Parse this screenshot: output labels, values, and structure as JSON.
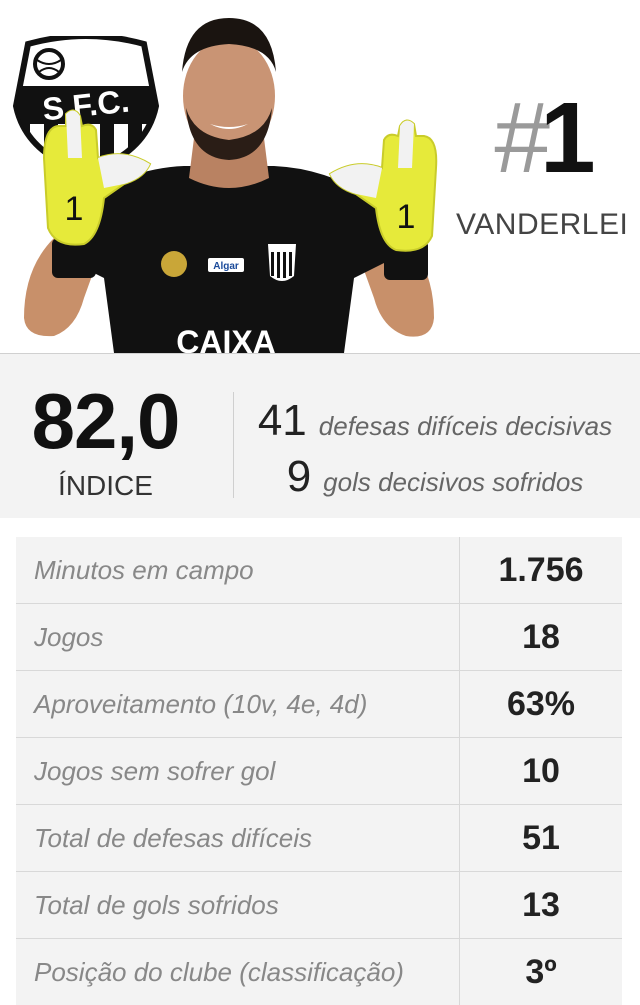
{
  "header": {
    "crest_text": "S.F.C.",
    "jersey_sponsor": "CAIXA",
    "jersey_badge": "Algar",
    "rank_symbol": "#",
    "rank_number": "1",
    "player_name": "VANDERLEI"
  },
  "summary": {
    "index_value": "82,0",
    "index_label": "ÍNDICE",
    "stats": [
      {
        "number": "41",
        "label": "defesas difíceis decisivas"
      },
      {
        "number": "9",
        "label": "gols decisivos sofridos"
      }
    ]
  },
  "table": {
    "rows": [
      {
        "label": "Minutos em campo",
        "value": "1.756"
      },
      {
        "label": "Jogos",
        "value": "18"
      },
      {
        "label": "Aproveitamento (10v, 4e, 4d)",
        "value": "63%"
      },
      {
        "label": "Jogos sem sofrer gol",
        "value": "10"
      },
      {
        "label": "Total de defesas difíceis",
        "value": "51"
      },
      {
        "label": "Total de gols sofridos",
        "value": "13"
      },
      {
        "label": "Posição do clube (classificação)",
        "value": "3º"
      }
    ]
  },
  "colors": {
    "glove_yellow": "#e6ea3a",
    "jersey_black": "#111111",
    "accent_gray": "#9a9a9a"
  }
}
